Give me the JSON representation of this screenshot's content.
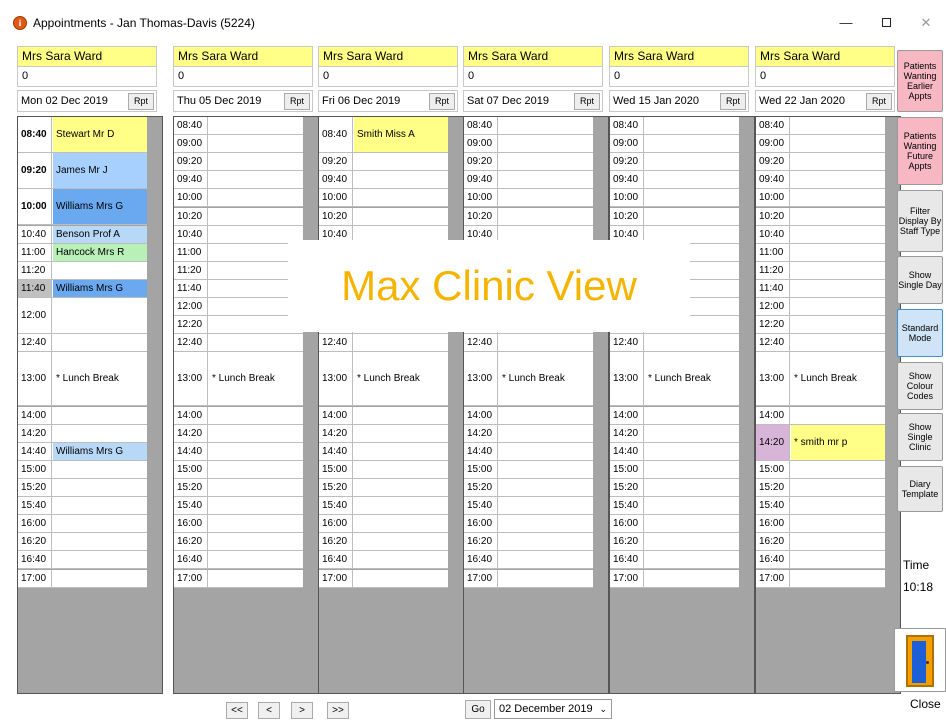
{
  "window": {
    "title": "Appointments - Jan Thomas-Davis (5224)",
    "min": "—",
    "close": "✕"
  },
  "columns": [
    {
      "staff": "Mrs Sara Ward",
      "count": "0",
      "date": "Mon 02 Dec 2019",
      "rpt": "Rpt",
      "slots": [
        {
          "time": "08:40",
          "name": "Stewart Mr D",
          "style": "yellow bold",
          "rows": 2
        },
        {
          "time": "09:20",
          "name": "James Mr J",
          "style": "lightblue bold",
          "rows": 2
        },
        {
          "time": "10:00",
          "name": "Williams Mrs G",
          "style": "blue bold",
          "rows": 2
        },
        {
          "time": "10:40",
          "name": "Benson Prof A",
          "style": "paleblue",
          "rows": 1
        },
        {
          "time": "11:00",
          "name": "Hancock Mrs R",
          "style": "green",
          "rows": 1
        },
        {
          "time": "11:20",
          "name": "",
          "style": "",
          "rows": 1
        },
        {
          "time": "11:40",
          "name": "Williams Mrs G",
          "style": "blue greyt",
          "rows": 1
        },
        {
          "time": "12:00",
          "name": "",
          "style": "",
          "rows": 2
        },
        {
          "time": "12:40",
          "name": "",
          "style": "",
          "rows": 1
        },
        {
          "time": "13:00",
          "name": "* Lunch Break",
          "style": "",
          "rows": 3
        },
        {
          "time": "14:00",
          "name": "",
          "style": "",
          "rows": 1
        },
        {
          "time": "14:20",
          "name": "",
          "style": "",
          "rows": 1
        },
        {
          "time": "14:40",
          "name": "Williams Mrs G",
          "style": "paleblue",
          "rows": 1
        },
        {
          "time": "15:00",
          "name": "",
          "style": "",
          "rows": 1
        },
        {
          "time": "15:20",
          "name": "",
          "style": "",
          "rows": 1
        },
        {
          "time": "15:40",
          "name": "",
          "style": "",
          "rows": 1
        },
        {
          "time": "16:00",
          "name": "",
          "style": "",
          "rows": 1
        },
        {
          "time": "16:20",
          "name": "",
          "style": "",
          "rows": 1
        },
        {
          "time": "16:40",
          "name": "",
          "style": "",
          "rows": 1
        },
        {
          "time": "17:00",
          "name": "",
          "style": "",
          "rows": 1
        }
      ]
    },
    {
      "staff": "Mrs Sara Ward",
      "count": "0",
      "date": "Thu 05 Dec 2019",
      "rpt": "Rpt",
      "slots": [
        {
          "time": "08:40",
          "name": "",
          "style": "",
          "rows": 1
        },
        {
          "time": "09:00",
          "name": "",
          "style": "",
          "rows": 1
        },
        {
          "time": "09:20",
          "name": "",
          "style": "",
          "rows": 1
        },
        {
          "time": "09:40",
          "name": "",
          "style": "",
          "rows": 1
        },
        {
          "time": "10:00",
          "name": "",
          "style": "",
          "rows": 1
        },
        {
          "time": "10:20",
          "name": "",
          "style": "",
          "rows": 1
        },
        {
          "time": "10:40",
          "name": "",
          "style": "",
          "rows": 1
        },
        {
          "time": "11:00",
          "name": "",
          "style": "",
          "rows": 1
        },
        {
          "time": "11:20",
          "name": "",
          "style": "",
          "rows": 1
        },
        {
          "time": "11:40",
          "name": "",
          "style": "",
          "rows": 1
        },
        {
          "time": "12:00",
          "name": "",
          "style": "",
          "rows": 1
        },
        {
          "time": "12:20",
          "name": "",
          "style": "",
          "rows": 1
        },
        {
          "time": "12:40",
          "name": "",
          "style": "",
          "rows": 1
        },
        {
          "time": "13:00",
          "name": "* Lunch Break",
          "style": "",
          "rows": 3
        },
        {
          "time": "14:00",
          "name": "",
          "style": "",
          "rows": 1
        },
        {
          "time": "14:20",
          "name": "",
          "style": "",
          "rows": 1
        },
        {
          "time": "14:40",
          "name": "",
          "style": "",
          "rows": 1
        },
        {
          "time": "15:00",
          "name": "",
          "style": "",
          "rows": 1
        },
        {
          "time": "15:20",
          "name": "",
          "style": "",
          "rows": 1
        },
        {
          "time": "15:40",
          "name": "",
          "style": "",
          "rows": 1
        },
        {
          "time": "16:00",
          "name": "",
          "style": "",
          "rows": 1
        },
        {
          "time": "16:20",
          "name": "",
          "style": "",
          "rows": 1
        },
        {
          "time": "16:40",
          "name": "",
          "style": "",
          "rows": 1
        },
        {
          "time": "17:00",
          "name": "",
          "style": "",
          "rows": 1
        }
      ]
    },
    {
      "staff": "Mrs Sara Ward",
      "count": "0",
      "date": "Fri 06 Dec 2019",
      "rpt": "Rpt",
      "slots": [
        {
          "time": "08:40",
          "name": "Smith Miss A",
          "style": "yellow",
          "rows": 2
        },
        {
          "time": "09:20",
          "name": "",
          "style": "",
          "rows": 1
        },
        {
          "time": "09:40",
          "name": "",
          "style": "",
          "rows": 1
        },
        {
          "time": "10:00",
          "name": "",
          "style": "",
          "rows": 1
        },
        {
          "time": "10:20",
          "name": "",
          "style": "",
          "rows": 1
        },
        {
          "time": "10:40",
          "name": "",
          "style": "",
          "rows": 1
        },
        {
          "time": "",
          "name": "",
          "style": "",
          "rows": 1
        },
        {
          "time": "",
          "name": "",
          "style": "",
          "rows": 1
        },
        {
          "time": "",
          "name": "",
          "style": "",
          "rows": 1
        },
        {
          "time": "",
          "name": "",
          "style": "",
          "rows": 1
        },
        {
          "time": "",
          "name": "",
          "style": "",
          "rows": 1
        },
        {
          "time": "12:40",
          "name": "",
          "style": "",
          "rows": 1
        },
        {
          "time": "13:00",
          "name": "* Lunch Break",
          "style": "",
          "rows": 3
        },
        {
          "time": "14:00",
          "name": "",
          "style": "",
          "rows": 1
        },
        {
          "time": "14:20",
          "name": "",
          "style": "",
          "rows": 1
        },
        {
          "time": "14:40",
          "name": "",
          "style": "",
          "rows": 1
        },
        {
          "time": "15:00",
          "name": "",
          "style": "",
          "rows": 1
        },
        {
          "time": "15:20",
          "name": "",
          "style": "",
          "rows": 1
        },
        {
          "time": "15:40",
          "name": "",
          "style": "",
          "rows": 1
        },
        {
          "time": "16:00",
          "name": "",
          "style": "",
          "rows": 1
        },
        {
          "time": "16:20",
          "name": "",
          "style": "",
          "rows": 1
        },
        {
          "time": "16:40",
          "name": "",
          "style": "",
          "rows": 1
        },
        {
          "time": "17:00",
          "name": "",
          "style": "",
          "rows": 1
        }
      ]
    },
    {
      "staff": "Mrs Sara Ward",
      "count": "0",
      "date": "Sat 07 Dec 2019",
      "rpt": "Rpt",
      "slots": [
        {
          "time": "08:40",
          "name": "",
          "style": "",
          "rows": 1
        },
        {
          "time": "09:00",
          "name": "",
          "style": "",
          "rows": 1
        },
        {
          "time": "09:20",
          "name": "",
          "style": "",
          "rows": 1
        },
        {
          "time": "09:40",
          "name": "",
          "style": "",
          "rows": 1
        },
        {
          "time": "10:00",
          "name": "",
          "style": "",
          "rows": 1
        },
        {
          "time": "10:20",
          "name": "",
          "style": "",
          "rows": 1
        },
        {
          "time": "10:40",
          "name": "",
          "style": "",
          "rows": 1
        },
        {
          "time": "",
          "name": "",
          "style": "",
          "rows": 1
        },
        {
          "time": "",
          "name": "",
          "style": "",
          "rows": 1
        },
        {
          "time": "",
          "name": "",
          "style": "",
          "rows": 1
        },
        {
          "time": "",
          "name": "",
          "style": "",
          "rows": 1
        },
        {
          "time": "",
          "name": "",
          "style": "",
          "rows": 1
        },
        {
          "time": "12:40",
          "name": "",
          "style": "",
          "rows": 1
        },
        {
          "time": "13:00",
          "name": "* Lunch Break",
          "style": "",
          "rows": 3
        },
        {
          "time": "14:00",
          "name": "",
          "style": "",
          "rows": 1
        },
        {
          "time": "14:20",
          "name": "",
          "style": "",
          "rows": 1
        },
        {
          "time": "14:40",
          "name": "",
          "style": "",
          "rows": 1
        },
        {
          "time": "15:00",
          "name": "",
          "style": "",
          "rows": 1
        },
        {
          "time": "15:20",
          "name": "",
          "style": "",
          "rows": 1
        },
        {
          "time": "15:40",
          "name": "",
          "style": "",
          "rows": 1
        },
        {
          "time": "16:00",
          "name": "",
          "style": "",
          "rows": 1
        },
        {
          "time": "16:20",
          "name": "",
          "style": "",
          "rows": 1
        },
        {
          "time": "16:40",
          "name": "",
          "style": "",
          "rows": 1
        },
        {
          "time": "17:00",
          "name": "",
          "style": "",
          "rows": 1
        }
      ]
    },
    {
      "staff": "Mrs Sara Ward",
      "count": "0",
      "date": "Wed 15 Jan 2020",
      "rpt": "Rpt",
      "slots": [
        {
          "time": "08:40",
          "name": "",
          "style": "",
          "rows": 1
        },
        {
          "time": "09:00",
          "name": "",
          "style": "",
          "rows": 1
        },
        {
          "time": "09:20",
          "name": "",
          "style": "",
          "rows": 1
        },
        {
          "time": "09:40",
          "name": "",
          "style": "",
          "rows": 1
        },
        {
          "time": "10:00",
          "name": "",
          "style": "",
          "rows": 1
        },
        {
          "time": "10:20",
          "name": "",
          "style": "",
          "rows": 1
        },
        {
          "time": "10:40",
          "name": "",
          "style": "",
          "rows": 1
        },
        {
          "time": "",
          "name": "",
          "style": "",
          "rows": 1
        },
        {
          "time": "",
          "name": "",
          "style": "",
          "rows": 1
        },
        {
          "time": "",
          "name": "",
          "style": "",
          "rows": 1
        },
        {
          "time": "",
          "name": "",
          "style": "",
          "rows": 1
        },
        {
          "time": "",
          "name": "",
          "style": "",
          "rows": 1
        },
        {
          "time": "12:40",
          "name": "",
          "style": "",
          "rows": 1
        },
        {
          "time": "13:00",
          "name": "* Lunch Break",
          "style": "",
          "rows": 3
        },
        {
          "time": "14:00",
          "name": "",
          "style": "",
          "rows": 1
        },
        {
          "time": "14:20",
          "name": "",
          "style": "",
          "rows": 1
        },
        {
          "time": "14:40",
          "name": "",
          "style": "",
          "rows": 1
        },
        {
          "time": "15:00",
          "name": "",
          "style": "",
          "rows": 1
        },
        {
          "time": "15:20",
          "name": "",
          "style": "",
          "rows": 1
        },
        {
          "time": "15:40",
          "name": "",
          "style": "",
          "rows": 1
        },
        {
          "time": "16:00",
          "name": "",
          "style": "",
          "rows": 1
        },
        {
          "time": "16:20",
          "name": "",
          "style": "",
          "rows": 1
        },
        {
          "time": "16:40",
          "name": "",
          "style": "",
          "rows": 1
        },
        {
          "time": "17:00",
          "name": "",
          "style": "",
          "rows": 1
        }
      ]
    },
    {
      "staff": "Mrs Sara Ward",
      "count": "0",
      "date": "Wed 22 Jan 2020",
      "rpt": "Rpt",
      "slots": [
        {
          "time": "08:40",
          "name": "",
          "style": "",
          "rows": 1
        },
        {
          "time": "09:00",
          "name": "",
          "style": "",
          "rows": 1
        },
        {
          "time": "09:20",
          "name": "",
          "style": "",
          "rows": 1
        },
        {
          "time": "09:40",
          "name": "",
          "style": "",
          "rows": 1
        },
        {
          "time": "10:00",
          "name": "",
          "style": "",
          "rows": 1
        },
        {
          "time": "10:20",
          "name": "",
          "style": "",
          "rows": 1
        },
        {
          "time": "10:40",
          "name": "",
          "style": "",
          "rows": 1
        },
        {
          "time": "11:00",
          "name": "",
          "style": "",
          "rows": 1
        },
        {
          "time": "11:20",
          "name": "",
          "style": "",
          "rows": 1
        },
        {
          "time": "11:40",
          "name": "",
          "style": "",
          "rows": 1
        },
        {
          "time": "12:00",
          "name": "",
          "style": "",
          "rows": 1
        },
        {
          "time": "12:20",
          "name": "",
          "style": "",
          "rows": 1
        },
        {
          "time": "12:40",
          "name": "",
          "style": "",
          "rows": 1
        },
        {
          "time": "13:00",
          "name": "* Lunch Break",
          "style": "",
          "rows": 3
        },
        {
          "time": "14:00",
          "name": "",
          "style": "",
          "rows": 1
        },
        {
          "time": "14:20",
          "name": "* smith mr p",
          "style": "yellow mauvet",
          "rows": 2
        },
        {
          "time": "15:00",
          "name": "",
          "style": "",
          "rows": 1
        },
        {
          "time": "15:20",
          "name": "",
          "style": "",
          "rows": 1
        },
        {
          "time": "15:40",
          "name": "",
          "style": "",
          "rows": 1
        },
        {
          "time": "16:00",
          "name": "",
          "style": "",
          "rows": 1
        },
        {
          "time": "16:20",
          "name": "",
          "style": "",
          "rows": 1
        },
        {
          "time": "16:40",
          "name": "",
          "style": "",
          "rows": 1
        },
        {
          "time": "17:00",
          "name": "",
          "style": "",
          "rows": 1
        }
      ]
    }
  ],
  "sidebar": {
    "earlier": "Patients Wanting Earlier Appts",
    "future": "Patients Wanting Future Appts",
    "filter": "Filter Display By Staff Type",
    "single_day": "Show Single Day",
    "standard": "Standard Mode",
    "colour": "Show Colour Codes",
    "single_clinic": "Show Single Clinic",
    "template": "Diary Template",
    "time_label": "Time",
    "time_value": "10:18",
    "close": "Close"
  },
  "watermark": "Max Clinic View",
  "nav": {
    "first": "<<",
    "prev": "<",
    "next": ">",
    "last": ">>",
    "go": "Go",
    "date": "02 December 2019"
  },
  "colors": {
    "staff_header": "#ffff88",
    "appt_blue": "#6aa8f0",
    "appt_lightblue": "#a8d0ff",
    "appt_green": "#b8f0b8",
    "sidebar_pink": "#f7b8c4",
    "watermark": "#f4b400"
  }
}
